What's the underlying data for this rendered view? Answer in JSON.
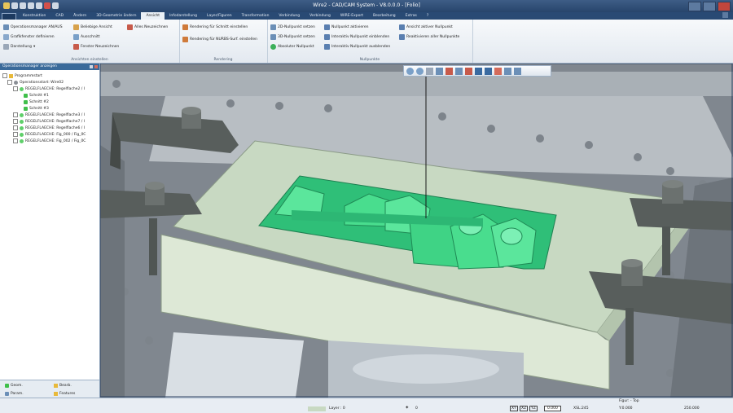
{
  "window": {
    "title": "Wire2 - CAD/CAM System - V8.0.0.0 - [Folio]"
  },
  "menu_tabs": [
    {
      "label": "Konstruktion"
    },
    {
      "label": "CAD"
    },
    {
      "label": "Ändern"
    },
    {
      "label": "3D-Geometrie ändern"
    },
    {
      "label": "Ansicht",
      "active": true
    },
    {
      "label": "Infodarstellung"
    },
    {
      "label": "Layer/Figuren"
    },
    {
      "label": "Transformation"
    },
    {
      "label": "Verbindung"
    },
    {
      "label": "Verbindung"
    },
    {
      "label": "WIRE-Export"
    },
    {
      "label": "Bearbeitung"
    },
    {
      "label": "Extras"
    },
    {
      "label": "?"
    }
  ],
  "ribbon": {
    "groups": [
      {
        "label": "Ansichten einstellen"
      },
      {
        "label": "Rendering"
      },
      {
        "label": "Nullpunkte"
      }
    ],
    "buttons": {
      "op_manager": "Operationsmanager AN/AUS",
      "graphic_window": "Grafikfenster definieren",
      "display": "Darstellung",
      "previous_view": "Beliebige Ansicht",
      "zoom_window": "Ausschnitt",
      "redraw_window": "Fenster Neuzeichnen",
      "redraw_all": "Alles Neuzeichnen",
      "render_cut": "Rendering für Schnitt einstellen",
      "render_nurbs": "Rendering für NURBS-Surf. einstellen",
      "set_2d_zero": "2D-Nullpunkt setzen",
      "set_3d_zero": "3D-Nullpunkt setzen",
      "absolute_zero": "Absoluter Nullpunkt",
      "activate_zero": "Nullpunkt aktivieren",
      "show_interactive_zero": "Interaktiv Nullpunkt einblenden",
      "hide_interactive_zero": "Interaktiv Nullpunkt ausblenden",
      "view_active_zero": "Ansicht aktiver Nullpunkt",
      "reactivate_all_zero": "Reaktivieren aller Nullpunkte"
    }
  },
  "left_panel": {
    "title": "Operationsmanager anzeigen",
    "tree": [
      {
        "label": "Programmstart",
        "level": 0
      },
      {
        "label": "Operationsstart: Wire02",
        "level": 1
      },
      {
        "label": "REGELFLAECHE: Regelflache2 / I",
        "level": 2
      },
      {
        "label": "Schnitt #1",
        "level": 3
      },
      {
        "label": "Schnitt #2",
        "level": 3
      },
      {
        "label": "Schnitt #3",
        "level": 3
      },
      {
        "label": "REGELFLAECHE: Regelflache3 / I",
        "level": 2
      },
      {
        "label": "REGELFLAECHE: Regelflache7 / I",
        "level": 2
      },
      {
        "label": "REGELFLAECHE: Regelflache6 / I",
        "level": 2
      },
      {
        "label": "REGELFLAECHE: Fig_000 / Fig_0C",
        "level": 2
      },
      {
        "label": "REGELFLAECHE: Fig_002 / Fig_0C",
        "level": 2
      }
    ],
    "bottom_tabs": [
      {
        "label": "Geom."
      },
      {
        "label": "Bearb."
      },
      {
        "label": "Param."
      },
      {
        "label": "Features"
      }
    ]
  },
  "statusbar": {
    "view_label": "Figur: - Top",
    "layer": "Layer : 0",
    "count": "0",
    "axis_xy": "XY",
    "axis_xz": "XZ",
    "axis_yz": "YZ",
    "value": "0.000",
    "xsl": "XSL:245",
    "coord1": "Y:0.000",
    "coord2": "250.000"
  },
  "colors": {
    "accent": "#3cdf8c",
    "ribbon_bg": "#e3e9f0",
    "titlebar": "#27456c",
    "workpiece": "#c8d9c2"
  }
}
